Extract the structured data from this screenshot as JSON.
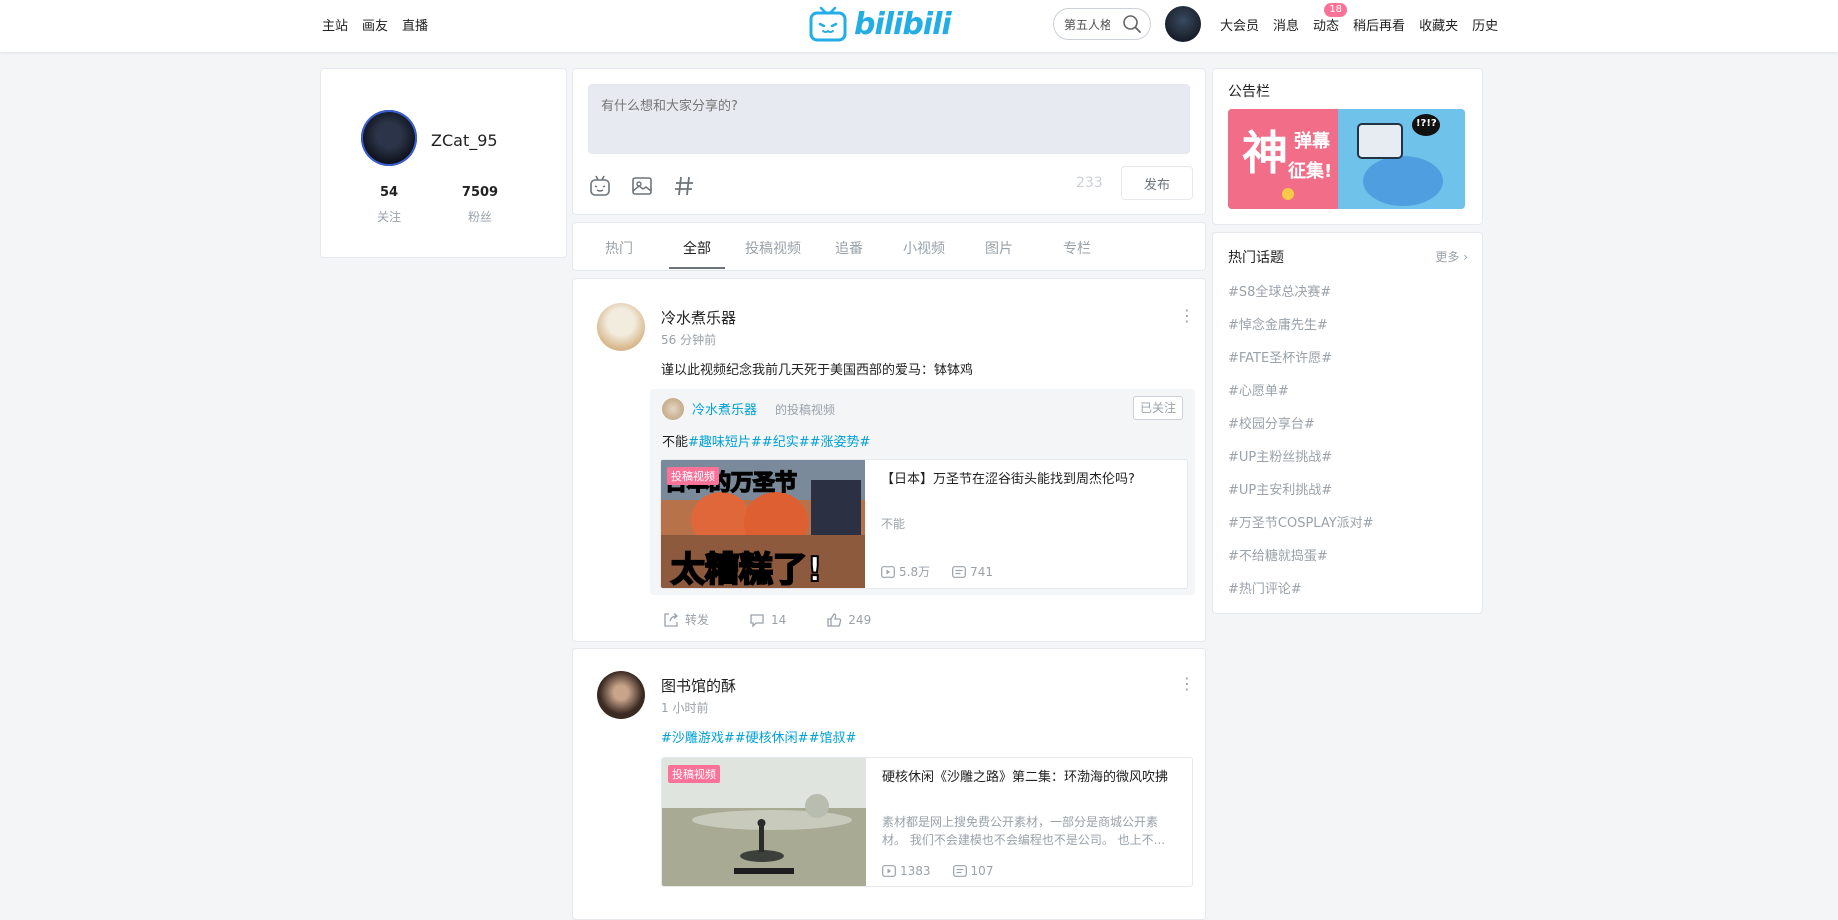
{
  "nav": {
    "home": "主站",
    "drawing": "画友",
    "live": "直播"
  },
  "logo": {
    "text": "bilibili"
  },
  "search": {
    "value": "第五人格"
  },
  "user_nav": {
    "vip": "大会员",
    "messages": "消息",
    "dynamics": "动态",
    "dynamics_badge": "18",
    "watch_later": "稍后再看",
    "favorites": "收藏夹",
    "history": "历史"
  },
  "profile": {
    "username": "ZCat_95",
    "following_count": "54",
    "following_label": "关注",
    "followers_count": "7509",
    "followers_label": "粉丝"
  },
  "composer": {
    "placeholder": "有什么想和大家分享的?",
    "char_count": "233",
    "publish_label": "发布"
  },
  "tabs": [
    "热门",
    "全部",
    "投稿视频",
    "追番",
    "小视频",
    "图片",
    "专栏"
  ],
  "posts": [
    {
      "author": "冷水煮乐器",
      "time": "56 分钟前",
      "text": "谨以此视频纪念我前几天死于美国西部的爱马：钵钵鸡",
      "repost": {
        "author": "冷水煮乐器",
        "type": "的投稿视频",
        "follow_label": "已关注",
        "text_prefix": "不能",
        "tags": "#趣味短片##纪实##涨姿势#",
        "video": {
          "badge": "投稿视频",
          "thumb_caption_top": "日本的万圣节",
          "thumb_caption_bottom_1": "太",
          "thumb_caption_bottom_2": "糟糕",
          "thumb_caption_bottom_3": "了!",
          "title": "【日本】万圣节在涩谷街头能找到周杰伦吗?",
          "desc": "不能",
          "plays": "5.8万",
          "danmaku": "741"
        }
      },
      "actions": {
        "share": "转发",
        "comments": "14",
        "likes": "249"
      }
    },
    {
      "author": "图书馆的酥",
      "time": "1 小时前",
      "tags": "#沙雕游戏##硬核休闲##馆叔#",
      "video": {
        "badge": "投稿视频",
        "title": "硬核休闲《沙雕之路》第二集：环渤海的微风吹拂",
        "desc": "素材都是网上搜免费公开素材，一部分是商城公开素材。 我们不会建模也不会编程也不是公司。 也上不...",
        "plays": "1383",
        "danmaku": "107"
      }
    }
  ],
  "notice": {
    "title": "公告栏",
    "banner_big": "神",
    "banner_line1": "弹幕",
    "banner_line2": "征集!",
    "banner_bubble": "!?!?"
  },
  "topics": {
    "title": "热门话题",
    "more": "更多",
    "items": [
      "#S8全球总决赛#",
      "#悼念金庸先生#",
      "#FATE圣杯许愿#",
      "#心愿单#",
      "#校园分享台#",
      "#UP主粉丝挑战#",
      "#UP主安利挑战#",
      "#万圣节COSPLAY派对#",
      "#不给糖就捣蛋#",
      "#热门评论#"
    ]
  },
  "colors": {
    "brand_blue": "#00a1d6",
    "pink": "#fb7299",
    "bg": "#f4f5f7"
  }
}
